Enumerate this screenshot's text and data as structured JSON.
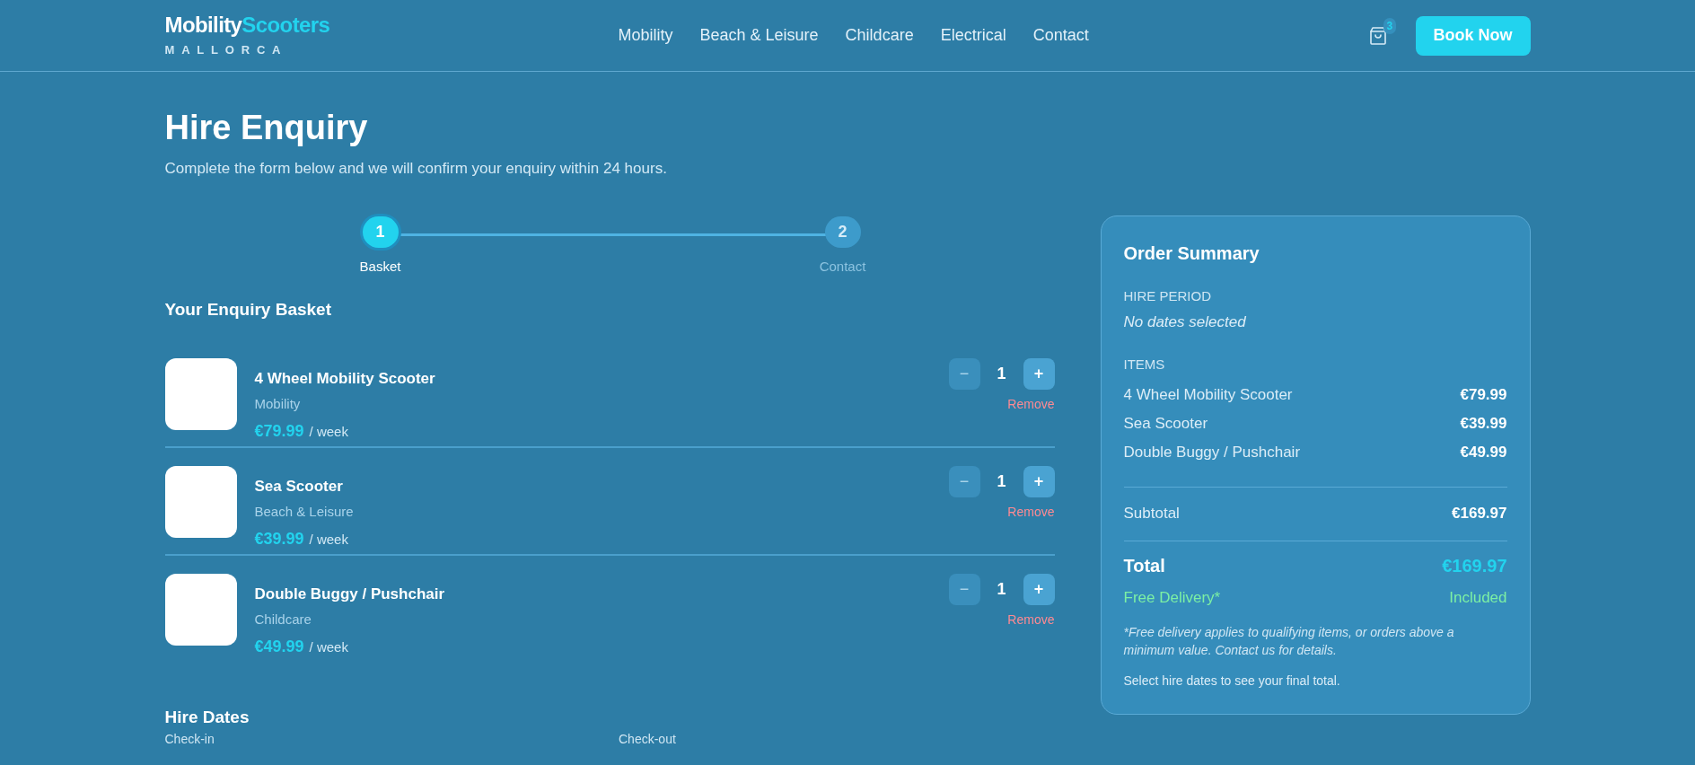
{
  "header": {
    "logo": {
      "word_1": "Mobility",
      "word_2": "Scooters",
      "tagline": "MALLORCA"
    },
    "nav": [
      "Mobility",
      "Beach & Leisure",
      "Childcare",
      "Electrical",
      "Contact"
    ],
    "cart_count": "3",
    "cta": "Book Now"
  },
  "page": {
    "title": "Hire Enquiry",
    "subtitle": "Complete the form below and we will confirm your enquiry within 24 hours."
  },
  "steps": [
    {
      "number": "1",
      "label": "Basket",
      "selected": true
    },
    {
      "number": "2",
      "label": "Contact",
      "selected": false
    }
  ],
  "basket": {
    "heading": "Your Enquiry Basket",
    "items": [
      {
        "name": "4 Wheel Mobility Scooter",
        "category": "Mobility",
        "price": "€79.99",
        "unit": "/ week",
        "decrease": "−",
        "quantity": "1",
        "increase": "+",
        "decrease_disabled": true,
        "remove": "Remove"
      },
      {
        "name": "Sea Scooter",
        "category": "Beach & Leisure",
        "price": "€39.99",
        "unit": "/ week",
        "decrease": "−",
        "quantity": "1",
        "increase": "+",
        "decrease_disabled": true,
        "remove": "Remove"
      },
      {
        "name": "Double Buggy / Pushchair",
        "category": "Childcare",
        "price": "€49.99",
        "unit": "/ week",
        "decrease": "−",
        "quantity": "1",
        "increase": "+",
        "decrease_disabled": true,
        "remove": "Remove"
      }
    ]
  },
  "hire_dates": {
    "heading": "Hire Dates",
    "fields": [
      "Check-in",
      "Check-out"
    ]
  },
  "summary": {
    "title": "Order Summary",
    "period_label": "HIRE PERIOD",
    "period_value": "No dates selected",
    "items_label": "ITEMS",
    "items": [
      {
        "name": "4 Wheel Mobility Scooter",
        "price": "€79.99"
      },
      {
        "name": "Sea Scooter",
        "price": "€39.99"
      },
      {
        "name": "Double Buggy / Pushchair",
        "price": "€49.99"
      }
    ],
    "subtotal_label": "Subtotal",
    "subtotal": "€169.97",
    "total_label": "Total",
    "total": "€169.97",
    "delivery_label": "Free Delivery*",
    "delivery_value": "Included",
    "footnote": "*Free delivery applies to qualifying items, or orders above a minimum value. Contact us for details.",
    "note": "Select hire dates to see your final total."
  }
}
